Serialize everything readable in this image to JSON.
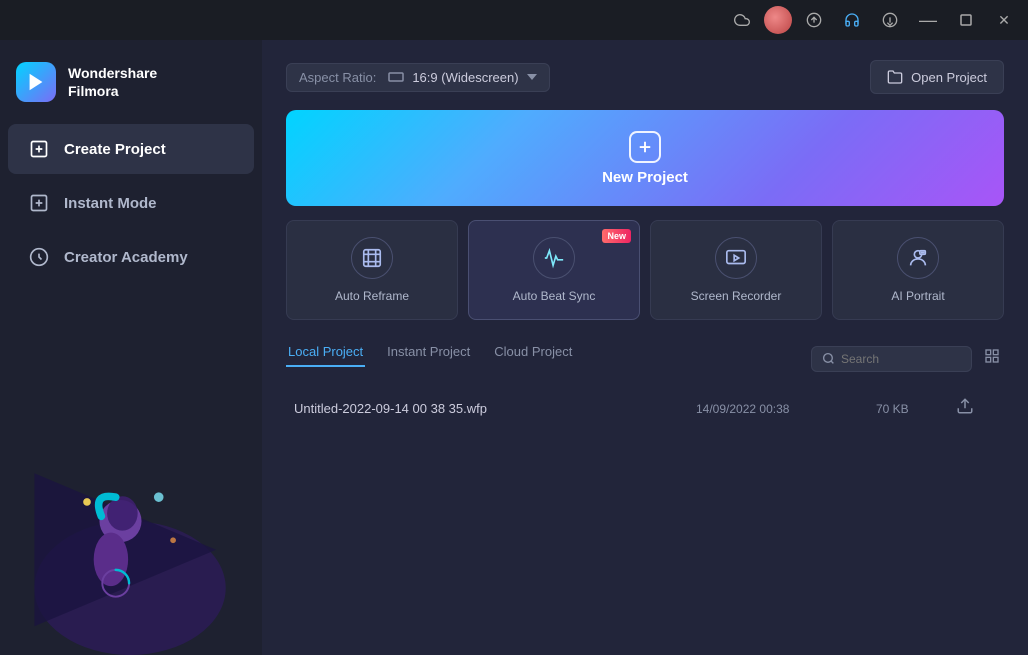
{
  "app": {
    "name": "Wondershare",
    "subtitle": "Filmora",
    "logo_char": "▶"
  },
  "titlebar": {
    "minimize_label": "—",
    "maximize_label": "□",
    "close_label": "✕"
  },
  "sidebar": {
    "nav_items": [
      {
        "id": "create-project",
        "label": "Create Project",
        "active": true,
        "icon": "plus-square"
      },
      {
        "id": "instant-mode",
        "label": "Instant Mode",
        "active": false,
        "icon": "instant"
      },
      {
        "id": "creator-academy",
        "label": "Creator Academy",
        "active": false,
        "icon": "mortarboard"
      }
    ]
  },
  "main": {
    "aspect_ratio_label": "Aspect Ratio:",
    "aspect_ratio_value": "16:9 (Widescreen)",
    "open_project_label": "Open Project",
    "new_project_label": "New Project",
    "feature_cards": [
      {
        "id": "auto-reframe",
        "label": "Auto Reframe",
        "icon": "⬜",
        "new": false
      },
      {
        "id": "auto-beat-sync",
        "label": "Auto Beat Sync",
        "icon": "♫",
        "new": true
      },
      {
        "id": "screen-recorder",
        "label": "Screen Recorder",
        "icon": "▶",
        "new": false
      },
      {
        "id": "ai-portrait",
        "label": "AI Portrait",
        "icon": "👤",
        "new": false
      }
    ],
    "tabs": [
      {
        "id": "local",
        "label": "Local Project",
        "active": true
      },
      {
        "id": "instant",
        "label": "Instant Project",
        "active": false
      },
      {
        "id": "cloud",
        "label": "Cloud Project",
        "active": false
      }
    ],
    "search_placeholder": "Search",
    "projects": [
      {
        "name": "Untitled-2022-09-14 00 38 35.wfp",
        "date": "14/09/2022 00:38",
        "size": "70 KB"
      }
    ]
  }
}
